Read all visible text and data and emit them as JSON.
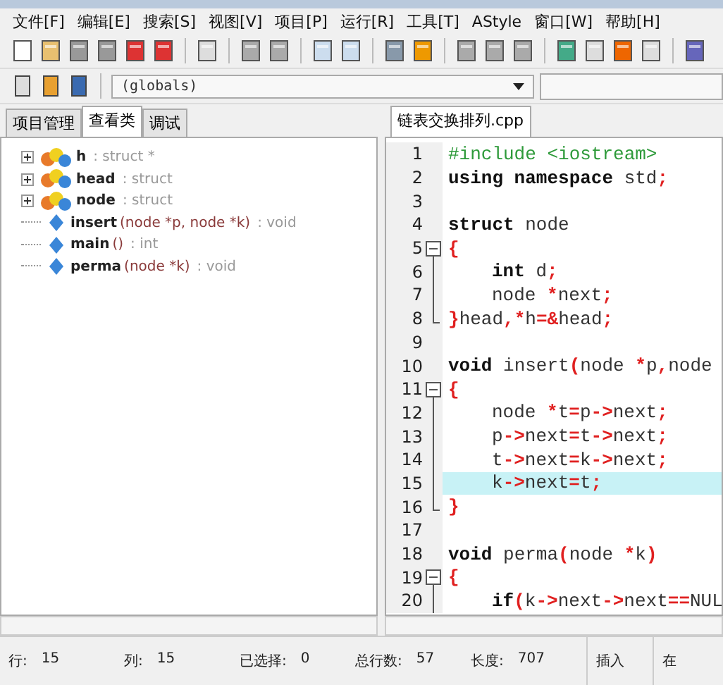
{
  "menu": [
    "文件[F]",
    "编辑[E]",
    "搜索[S]",
    "视图[V]",
    "项目[P]",
    "运行[R]",
    "工具[T]",
    "AStyle",
    "窗口[W]",
    "帮助[H]"
  ],
  "scope": {
    "value": "(globals)"
  },
  "left_tabs": [
    {
      "label": "项目管理",
      "selected": false
    },
    {
      "label": "查看类",
      "selected": true
    },
    {
      "label": "调试",
      "selected": false
    }
  ],
  "class_tree": [
    {
      "kind": "struct",
      "name": "h",
      "type": ": struct *"
    },
    {
      "kind": "struct",
      "name": "head",
      "type": ": struct"
    },
    {
      "kind": "struct",
      "name": "node",
      "type": ": struct"
    },
    {
      "kind": "function",
      "name": "insert",
      "signature": "(node *p, node *k)",
      "type": ": void"
    },
    {
      "kind": "function",
      "name": "main",
      "signature": "()",
      "type": ": int"
    },
    {
      "kind": "function",
      "name": "perma",
      "signature": "(node *k)",
      "type": ": void"
    }
  ],
  "editor_tabs": [
    {
      "label": "链表交换排列.cpp",
      "selected": true
    }
  ],
  "code": [
    {
      "n": "1",
      "indented": false,
      "selected": false,
      "tokens": [
        {
          "kind": "pp",
          "text": "#include <iostream>"
        }
      ]
    },
    {
      "n": "2",
      "indented": false,
      "selected": false,
      "tokens": [
        {
          "kind": "kw",
          "text": "using namespace"
        },
        {
          "kind": "id",
          "text": " std"
        },
        {
          "kind": "op",
          "text": ";"
        }
      ]
    },
    {
      "n": "3",
      "selected": false
    },
    {
      "n": "4",
      "indented": false,
      "selected": false,
      "tokens": [
        {
          "kind": "kw",
          "text": "struct"
        },
        {
          "kind": "id",
          "text": " node"
        }
      ]
    },
    {
      "n": "5",
      "fold": {
        "kind": "start"
      },
      "indented": false,
      "selected": false,
      "tokens": [
        {
          "kind": "op",
          "text": "{"
        }
      ]
    },
    {
      "n": "6",
      "fold": {
        "kind": "line"
      },
      "indented": true,
      "selected": false,
      "tokens": [
        {
          "kind": "kw",
          "text": "int"
        },
        {
          "kind": "id",
          "text": " d"
        },
        {
          "kind": "op",
          "text": ";"
        }
      ]
    },
    {
      "n": "7",
      "fold": {
        "kind": "line"
      },
      "indented": true,
      "selected": false,
      "tokens": [
        {
          "kind": "id",
          "text": "node "
        },
        {
          "kind": "op",
          "text": "*"
        },
        {
          "kind": "id",
          "text": "next"
        },
        {
          "kind": "op",
          "text": ";"
        }
      ]
    },
    {
      "n": "8",
      "fold": {
        "kind": "end"
      },
      "indented": false,
      "selected": false,
      "tokens": [
        {
          "kind": "op",
          "text": "}"
        },
        {
          "kind": "id",
          "text": "head"
        },
        {
          "kind": "op",
          "text": ",*"
        },
        {
          "kind": "id",
          "text": "h"
        },
        {
          "kind": "op",
          "text": "=&"
        },
        {
          "kind": "id",
          "text": "head"
        },
        {
          "kind": "op",
          "text": ";"
        }
      ]
    },
    {
      "n": "9",
      "selected": false
    },
    {
      "n": "10",
      "indented": false,
      "selected": false,
      "tokens": [
        {
          "kind": "kw",
          "text": "void"
        },
        {
          "kind": "id",
          "text": " insert"
        },
        {
          "kind": "op",
          "text": "("
        },
        {
          "kind": "id",
          "text": "node "
        },
        {
          "kind": "op",
          "text": "*"
        },
        {
          "kind": "id",
          "text": "p"
        },
        {
          "kind": "op",
          "text": ","
        },
        {
          "kind": "id",
          "text": "node"
        }
      ]
    },
    {
      "n": "11",
      "fold": {
        "kind": "start"
      },
      "indented": false,
      "selected": false,
      "tokens": [
        {
          "kind": "op",
          "text": "{"
        }
      ]
    },
    {
      "n": "12",
      "fold": {
        "kind": "line"
      },
      "indented": true,
      "selected": false,
      "tokens": [
        {
          "kind": "id",
          "text": "node "
        },
        {
          "kind": "op",
          "text": "*"
        },
        {
          "kind": "id",
          "text": "t"
        },
        {
          "kind": "op",
          "text": "="
        },
        {
          "kind": "id",
          "text": "p"
        },
        {
          "kind": "op",
          "text": "->"
        },
        {
          "kind": "id",
          "text": "next"
        },
        {
          "kind": "op",
          "text": ";"
        }
      ]
    },
    {
      "n": "13",
      "fold": {
        "kind": "line"
      },
      "indented": true,
      "selected": false,
      "tokens": [
        {
          "kind": "id",
          "text": "p"
        },
        {
          "kind": "op",
          "text": "->"
        },
        {
          "kind": "id",
          "text": "next"
        },
        {
          "kind": "op",
          "text": "="
        },
        {
          "kind": "id",
          "text": "t"
        },
        {
          "kind": "op",
          "text": "->"
        },
        {
          "kind": "id",
          "text": "next"
        },
        {
          "kind": "op",
          "text": ";"
        }
      ]
    },
    {
      "n": "14",
      "fold": {
        "kind": "line"
      },
      "indented": true,
      "selected": false,
      "tokens": [
        {
          "kind": "id",
          "text": "t"
        },
        {
          "kind": "op",
          "text": "->"
        },
        {
          "kind": "id",
          "text": "next"
        },
        {
          "kind": "op",
          "text": "="
        },
        {
          "kind": "id",
          "text": "k"
        },
        {
          "kind": "op",
          "text": "->"
        },
        {
          "kind": "id",
          "text": "next"
        },
        {
          "kind": "op",
          "text": ";"
        }
      ]
    },
    {
      "n": "15",
      "fold": {
        "kind": "line"
      },
      "indented": true,
      "selected": true,
      "tokens": [
        {
          "kind": "id",
          "text": "k"
        },
        {
          "kind": "op",
          "text": "->"
        },
        {
          "kind": "id",
          "text": "next"
        },
        {
          "kind": "op",
          "text": "="
        },
        {
          "kind": "id",
          "text": "t"
        },
        {
          "kind": "op",
          "text": ";"
        }
      ]
    },
    {
      "n": "16",
      "fold": {
        "kind": "end"
      },
      "indented": false,
      "selected": false,
      "tokens": [
        {
          "kind": "op",
          "text": "}"
        }
      ]
    },
    {
      "n": "17",
      "selected": false
    },
    {
      "n": "18",
      "indented": false,
      "selected": false,
      "tokens": [
        {
          "kind": "kw",
          "text": "void"
        },
        {
          "kind": "id",
          "text": " perma"
        },
        {
          "kind": "op",
          "text": "("
        },
        {
          "kind": "id",
          "text": "node "
        },
        {
          "kind": "op",
          "text": "*"
        },
        {
          "kind": "id",
          "text": "k"
        },
        {
          "kind": "op",
          "text": ")"
        }
      ]
    },
    {
      "n": "19",
      "fold": {
        "kind": "start"
      },
      "indented": false,
      "selected": false,
      "tokens": [
        {
          "kind": "op",
          "text": "{"
        }
      ]
    },
    {
      "n": "20",
      "fold": {
        "kind": "line"
      },
      "indented": true,
      "selected": false,
      "tokens": [
        {
          "kind": "kw",
          "text": "if"
        },
        {
          "kind": "op",
          "text": "("
        },
        {
          "kind": "id",
          "text": "k"
        },
        {
          "kind": "op",
          "text": "->"
        },
        {
          "kind": "id",
          "text": "next"
        },
        {
          "kind": "op",
          "text": "->"
        },
        {
          "kind": "id",
          "text": "next"
        },
        {
          "kind": "op",
          "text": "=="
        },
        {
          "kind": "id",
          "text": "NUL"
        }
      ]
    }
  ],
  "status_bar": [
    {
      "label": "行:",
      "value": "15"
    },
    {
      "label": "列:",
      "value": "15"
    },
    {
      "label": "已选择:",
      "value": "0"
    },
    {
      "label": "总行数:",
      "value": "57"
    },
    {
      "label": "长度:",
      "value": "707"
    },
    {
      "label": "插入"
    },
    {
      "label": "在"
    }
  ]
}
